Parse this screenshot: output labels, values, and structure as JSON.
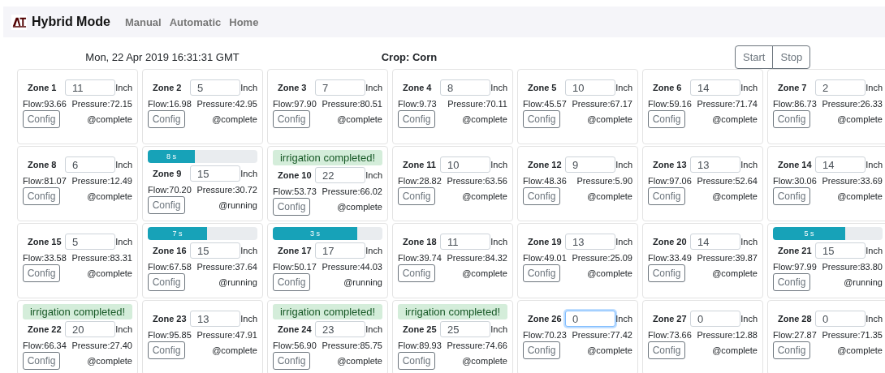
{
  "navbar": {
    "title": "Hybrid Mode",
    "links": [
      "Manual",
      "Automatic",
      "Home"
    ]
  },
  "date": "Mon, 22 Apr 2019 16:31:31 GMT",
  "crop": "Crop: Corn",
  "buttons": [
    "Start",
    "Stop"
  ],
  "zones": [
    {
      "name": "Zone 1",
      "value": "11",
      "unit": "Inch",
      "flow": "Flow:93.66",
      "pressure": "Pressure:72.15",
      "button": "Config",
      "status": "@complete",
      "focused": false
    },
    {
      "name": "Zone 2",
      "value": "5",
      "unit": "Inch",
      "flow": "Flow:16.98",
      "pressure": "Pressure:42.95",
      "button": "Config",
      "status": "@complete",
      "focused": false
    },
    {
      "name": "Zone 3",
      "value": "7",
      "unit": "Inch",
      "flow": "Flow:97.90",
      "pressure": "Pressure:80.51",
      "button": "Config",
      "status": "@complete",
      "focused": false
    },
    {
      "name": "Zone 4",
      "value": "8",
      "unit": "Inch",
      "flow": "Flow:9.73",
      "pressure": "Pressure:70.11",
      "button": "Config",
      "status": "@complete",
      "focused": false
    },
    {
      "name": "Zone 5",
      "value": "10",
      "unit": "Inch",
      "flow": "Flow:45.57",
      "pressure": "Pressure:67.17",
      "button": "Config",
      "status": "@complete",
      "focused": false
    },
    {
      "name": "Zone 6",
      "value": "14",
      "unit": "Inch",
      "flow": "Flow:59.16",
      "pressure": "Pressure:71.74",
      "button": "Config",
      "status": "@complete",
      "focused": false
    },
    {
      "name": "Zone 7",
      "value": "2",
      "unit": "Inch",
      "flow": "Flow:86.73",
      "pressure": "Pressure:26.33",
      "button": "Config",
      "status": "@complete",
      "focused": false
    },
    {
      "name": "Zone 8",
      "value": "6",
      "unit": "Inch",
      "flow": "Flow:81.07",
      "pressure": "Pressure:12.49",
      "button": "Config",
      "status": "@complete",
      "focused": false
    },
    {
      "name": "Zone 9",
      "value": "15",
      "unit": "Inch",
      "flow": "Flow:70.20",
      "pressure": "Pressure:30.72",
      "button": "Config",
      "status": "@running",
      "focused": false,
      "top": {
        "kind": "progress",
        "label": "8 s",
        "level": 0.43
      }
    },
    {
      "name": "Zone 10",
      "value": "22",
      "unit": "Inch",
      "flow": "Flow:53.73",
      "pressure": "Pressure:66.02",
      "button": "Config",
      "status": "@complete",
      "focused": false,
      "top": {
        "kind": "alert",
        "text": "irrigation completed!"
      }
    },
    {
      "name": "Zone 11",
      "value": "10",
      "unit": "Inch",
      "flow": "Flow:28.82",
      "pressure": "Pressure:63.56",
      "button": "Config",
      "status": "@complete",
      "focused": false
    },
    {
      "name": "Zone 12",
      "value": "9",
      "unit": "Inch",
      "flow": "Flow:48.36",
      "pressure": "Pressure:5.90",
      "button": "Config",
      "status": "@complete",
      "focused": false
    },
    {
      "name": "Zone 13",
      "value": "13",
      "unit": "Inch",
      "flow": "Flow:97.06",
      "pressure": "Pressure:52.64",
      "button": "Config",
      "status": "@complete",
      "focused": false
    },
    {
      "name": "Zone 14",
      "value": "14",
      "unit": "Inch",
      "flow": "Flow:30.06",
      "pressure": "Pressure:33.69",
      "button": "Config",
      "status": "@complete",
      "focused": false
    },
    {
      "name": "Zone 15",
      "value": "5",
      "unit": "Inch",
      "flow": "Flow:33.58",
      "pressure": "Pressure:83.31",
      "button": "Config",
      "status": "@complete",
      "focused": false
    },
    {
      "name": "Zone 16",
      "value": "15",
      "unit": "Inch",
      "flow": "Flow:67.58",
      "pressure": "Pressure:37.64",
      "button": "Config",
      "status": "@running",
      "focused": false,
      "top": {
        "kind": "progress",
        "label": "7 s",
        "level": 0.54
      }
    },
    {
      "name": "Zone 17",
      "value": "17",
      "unit": "Inch",
      "flow": "Flow:50.17",
      "pressure": "Pressure:44.03",
      "button": "Config",
      "status": "@running",
      "focused": false,
      "top": {
        "kind": "progress",
        "label": "3 s",
        "level": 0.77
      }
    },
    {
      "name": "Zone 18",
      "value": "11",
      "unit": "Inch",
      "flow": "Flow:39.74",
      "pressure": "Pressure:84.32",
      "button": "Config",
      "status": "@complete",
      "focused": false
    },
    {
      "name": "Zone 19",
      "value": "13",
      "unit": "Inch",
      "flow": "Flow:49.01",
      "pressure": "Pressure:25.09",
      "button": "Config",
      "status": "@complete",
      "focused": false
    },
    {
      "name": "Zone 20",
      "value": "14",
      "unit": "Inch",
      "flow": "Flow:33.49",
      "pressure": "Pressure:39.87",
      "button": "Config",
      "status": "@complete",
      "focused": false
    },
    {
      "name": "Zone 21",
      "value": "15",
      "unit": "Inch",
      "flow": "Flow:97.99",
      "pressure": "Pressure:83.80",
      "button": "Config",
      "status": "@running",
      "focused": false,
      "top": {
        "kind": "progress",
        "label": "5 s",
        "level": 0.66
      }
    },
    {
      "name": "Zone 22",
      "value": "20",
      "unit": "Inch",
      "flow": "Flow:66.34",
      "pressure": "Pressure:27.40",
      "button": "Config",
      "status": "@complete",
      "focused": false,
      "top": {
        "kind": "alert",
        "text": "irrigation completed!"
      }
    },
    {
      "name": "Zone 23",
      "value": "13",
      "unit": "Inch",
      "flow": "Flow:95.85",
      "pressure": "Pressure:47.91",
      "button": "Config",
      "status": "@complete",
      "focused": false
    },
    {
      "name": "Zone 24",
      "value": "23",
      "unit": "Inch",
      "flow": "Flow:56.90",
      "pressure": "Pressure:85.75",
      "button": "Config",
      "status": "@complete",
      "focused": false,
      "top": {
        "kind": "alert",
        "text": "irrigation completed!"
      }
    },
    {
      "name": "Zone 25",
      "value": "25",
      "unit": "Inch",
      "flow": "Flow:89.93",
      "pressure": "Pressure:74.66",
      "button": "Config",
      "status": "@complete",
      "focused": false,
      "top": {
        "kind": "alert",
        "text": "irrigation completed!"
      }
    },
    {
      "name": "Zone 26",
      "value": "0",
      "unit": "Inch",
      "flow": "Flow:70.23",
      "pressure": "Pressure:77.42",
      "button": "Config",
      "status": "@complete",
      "focused": true
    },
    {
      "name": "Zone 27",
      "value": "0",
      "unit": "Inch",
      "flow": "Flow:73.66",
      "pressure": "Pressure:12.88",
      "button": "Config",
      "status": "@complete",
      "focused": false
    },
    {
      "name": "Zone 28",
      "value": "0",
      "unit": "Inch",
      "flow": "Flow:27.87",
      "pressure": "Pressure:71.35",
      "button": "Config",
      "status": "@complete",
      "focused": false
    }
  ]
}
